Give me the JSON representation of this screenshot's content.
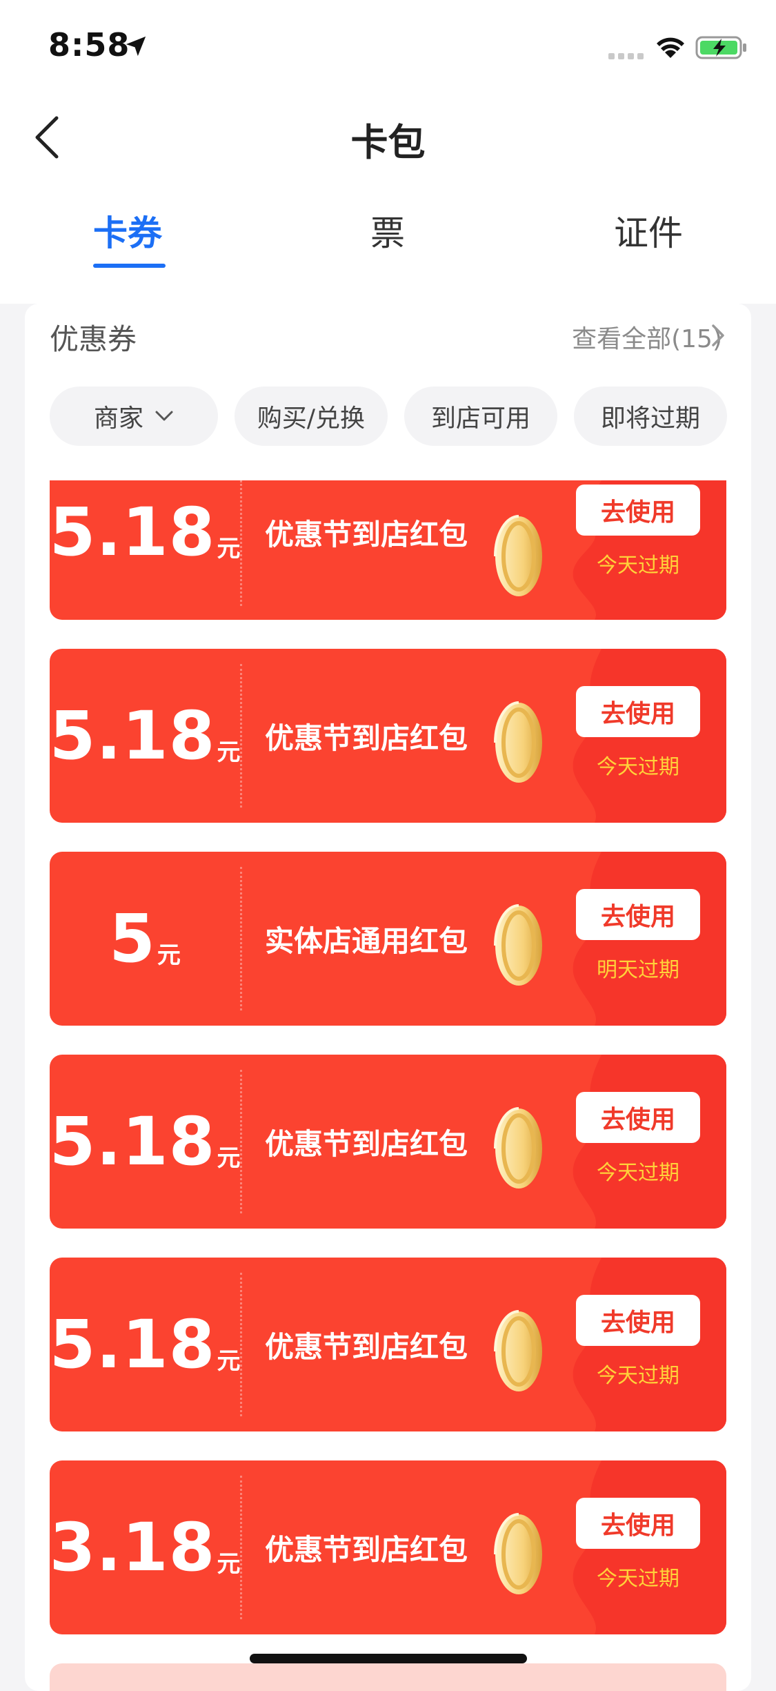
{
  "status_bar": {
    "time": "8:58"
  },
  "nav": {
    "title": "卡包"
  },
  "tabs": [
    {
      "label": "卡券",
      "active": true
    },
    {
      "label": "票",
      "active": false
    },
    {
      "label": "证件",
      "active": false
    }
  ],
  "section": {
    "title": "优惠券",
    "view_all": "查看全部(15)"
  },
  "filters": [
    {
      "label": "商家",
      "has_dropdown": true
    },
    {
      "label": "购买/兑换"
    },
    {
      "label": "到店可用"
    },
    {
      "label": "即将过期"
    }
  ],
  "coupons": [
    {
      "amount": "5.18",
      "unit": "元",
      "name": "优惠节到店红包",
      "button": "去使用",
      "expire": "今天过期"
    },
    {
      "amount": "5.18",
      "unit": "元",
      "name": "优惠节到店红包",
      "button": "去使用",
      "expire": "今天过期"
    },
    {
      "amount": "5",
      "unit": "元",
      "name": "实体店通用红包",
      "button": "去使用",
      "expire": "明天过期"
    },
    {
      "amount": "5.18",
      "unit": "元",
      "name": "优惠节到店红包",
      "button": "去使用",
      "expire": "今天过期"
    },
    {
      "amount": "5.18",
      "unit": "元",
      "name": "优惠节到店红包",
      "button": "去使用",
      "expire": "今天过期"
    },
    {
      "amount": "3.18",
      "unit": "元",
      "name": "优惠节到店红包",
      "button": "去使用",
      "expire": "今天过期"
    }
  ],
  "colors": {
    "accent": "#1c6ff5",
    "coupon_red": "#fb4330",
    "expire_yellow": "#ffd23a"
  },
  "icons": {
    "back": "chevron-left-icon",
    "view_all": "chevron-right-icon",
    "dropdown": "chevron-down-icon",
    "coin": "gold-coin-icon"
  }
}
